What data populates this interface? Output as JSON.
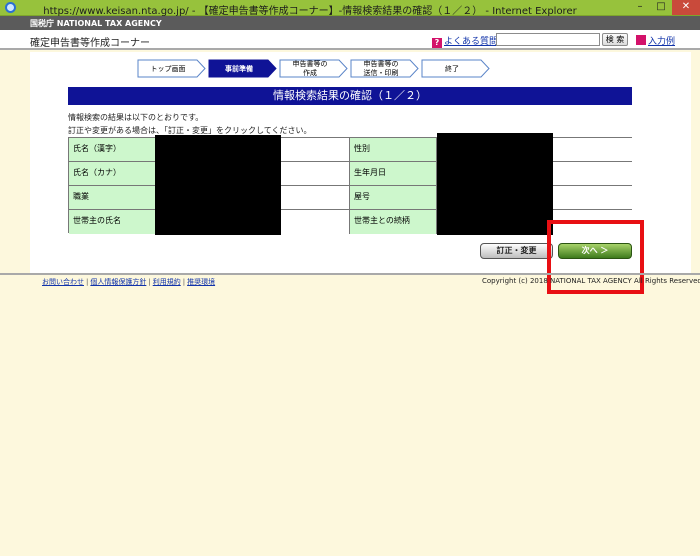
{
  "window": {
    "title": "https://www.keisan.nta.go.jp/ - 【確定申告書等作成コーナー】-情報検索結果の確認（１／２） - Internet Explorer",
    "min": "–",
    "max": "□",
    "close": "✕"
  },
  "header": {
    "agency": "国税庁 NATIONAL TAX AGENCY",
    "site_title": "確定申告書等作成コーナー",
    "faq_label": "よくある質問",
    "search_value": "",
    "search_button": "検 索",
    "example_label": "入力例"
  },
  "steps": [
    {
      "label": "トップ画面",
      "label2": ""
    },
    {
      "label": "事前準備",
      "label2": ""
    },
    {
      "label": "申告書等の",
      "label2": "作成"
    },
    {
      "label": "申告書等の",
      "label2": "送信・印刷"
    },
    {
      "label": "終了",
      "label2": ""
    }
  ],
  "main": {
    "heading": "情報検索結果の確認（１／２）",
    "intro1": "情報検索の結果は以下のとおりです。",
    "intro2": "訂正や変更がある場合は、「訂正・変更」をクリックしてください。"
  },
  "table": {
    "left_labels": [
      "氏名（漢字）",
      "氏名（カナ）",
      "職業",
      "世帯主の氏名"
    ],
    "right_labels": [
      "性別",
      "生年月日",
      "屋号",
      "世帯主との続柄"
    ]
  },
  "buttons": {
    "correct": "訂正・変更",
    "next": "次へ ＞"
  },
  "footer": {
    "links": [
      "お問い合わせ",
      "個人情報保護方針",
      "利用規約",
      "推奨環境"
    ],
    "copyright": "Copyright (c) 2018 NATIONAL TAX AGENCY All Rights Reserved."
  },
  "colors": {
    "titlebar": "#97c23c",
    "heading": "#0f1396",
    "label_cell": "#cdf7cc",
    "active_step": "#0f1396",
    "highlight": "#e80f13",
    "next_button": "#3e7b1d"
  }
}
